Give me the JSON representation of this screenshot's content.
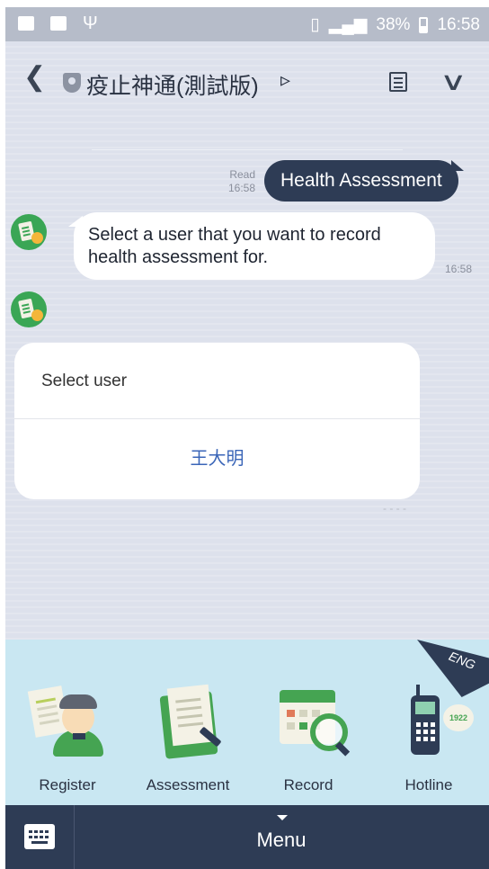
{
  "status_bar": {
    "battery": "38%",
    "time": "16:58"
  },
  "header": {
    "title": "疫止神通(測試版)"
  },
  "messages": {
    "sent": {
      "text": "Health Assessment",
      "read_label": "Read",
      "time": "16:58"
    },
    "received": {
      "text_line1": "Select a user that you want to record",
      "text_line2": "health assessment for.",
      "time": "16:58"
    }
  },
  "card": {
    "title": "Select user",
    "option": "王大明"
  },
  "rich_menu": {
    "language_badge": "ENG",
    "items": [
      {
        "label": "Register",
        "icon": "register-icon"
      },
      {
        "label": "Assessment",
        "icon": "assessment-icon"
      },
      {
        "label": "Record",
        "icon": "record-icon"
      },
      {
        "label": "Hotline",
        "icon": "hotline-icon",
        "badge": "1922"
      }
    ]
  },
  "bottom_bar": {
    "menu_label": "Menu"
  },
  "colors": {
    "navy": "#2e3c55",
    "chat_bg": "#dde1ec",
    "menu_bg": "#c9e7f2",
    "green": "#45a452",
    "link": "#3b66b8"
  }
}
